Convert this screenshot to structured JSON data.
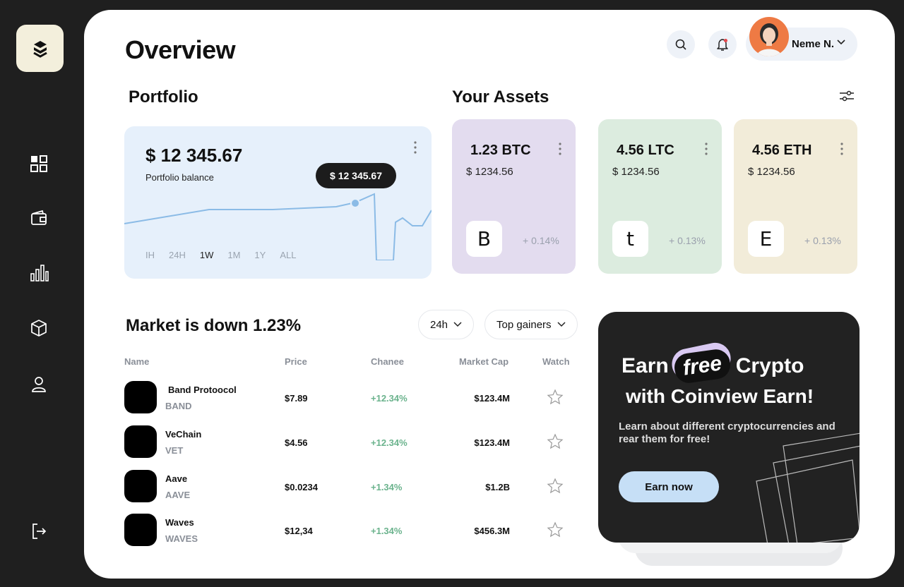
{
  "page": {
    "title": "Overview"
  },
  "header": {
    "user_name": "Neme N."
  },
  "portfolio": {
    "section_title": "Portfolio",
    "balance": "$ 12 345.67",
    "balance_label": "Portfolio balance",
    "tooltip": "$ 12 345.67",
    "ranges": [
      "IH",
      "24H",
      "1W",
      "1M",
      "1Y",
      "ALL"
    ],
    "active_range": "1W"
  },
  "assets": {
    "section_title": "Your Assets",
    "items": [
      {
        "amount": "1.23 BTC",
        "value": "$ 1234.56",
        "logo": "B",
        "change": "+ 0.14%",
        "color": "#e3dcef"
      },
      {
        "amount": "4.56 LTC",
        "value": "$ 1234.56",
        "logo": "t",
        "change": "+ 0.13%",
        "color": "#dcecdf"
      },
      {
        "amount": "4.56 ETH",
        "value": "$ 1234.56",
        "logo": "E",
        "change": "+ 0.13%",
        "color": "#f2ecd9"
      }
    ]
  },
  "market": {
    "title": "Market is down 1.23%",
    "period_filter": "24h",
    "sort_filter": "Top gainers",
    "columns": [
      "Name",
      "Price",
      "Chanee",
      "Market Cap",
      "Watch"
    ],
    "rows": [
      {
        "name": "Band Protoocol",
        "symbol": "BAND",
        "price": "$7.89",
        "change": "+12.34%",
        "cap": "$123.4M"
      },
      {
        "name": "VeChain",
        "symbol": "VET",
        "price": "$4.56",
        "change": "+12.34%",
        "cap": "$123.4M"
      },
      {
        "name": "Aave",
        "symbol": "AAVE",
        "price": "$0.0234",
        "change": "+1.34%",
        "cap": "$1.2B"
      },
      {
        "name": "Waves",
        "symbol": "WAVES",
        "price": "$12,34",
        "change": "+1.34%",
        "cap": "$456.3M"
      }
    ]
  },
  "promo": {
    "earn": "Earn",
    "free": "free",
    "crypto": "Crypto",
    "line2": "with Coinview Earn!",
    "description": "Learn about different cryptocurrencies and rear them for free!",
    "button": "Earn now"
  }
}
